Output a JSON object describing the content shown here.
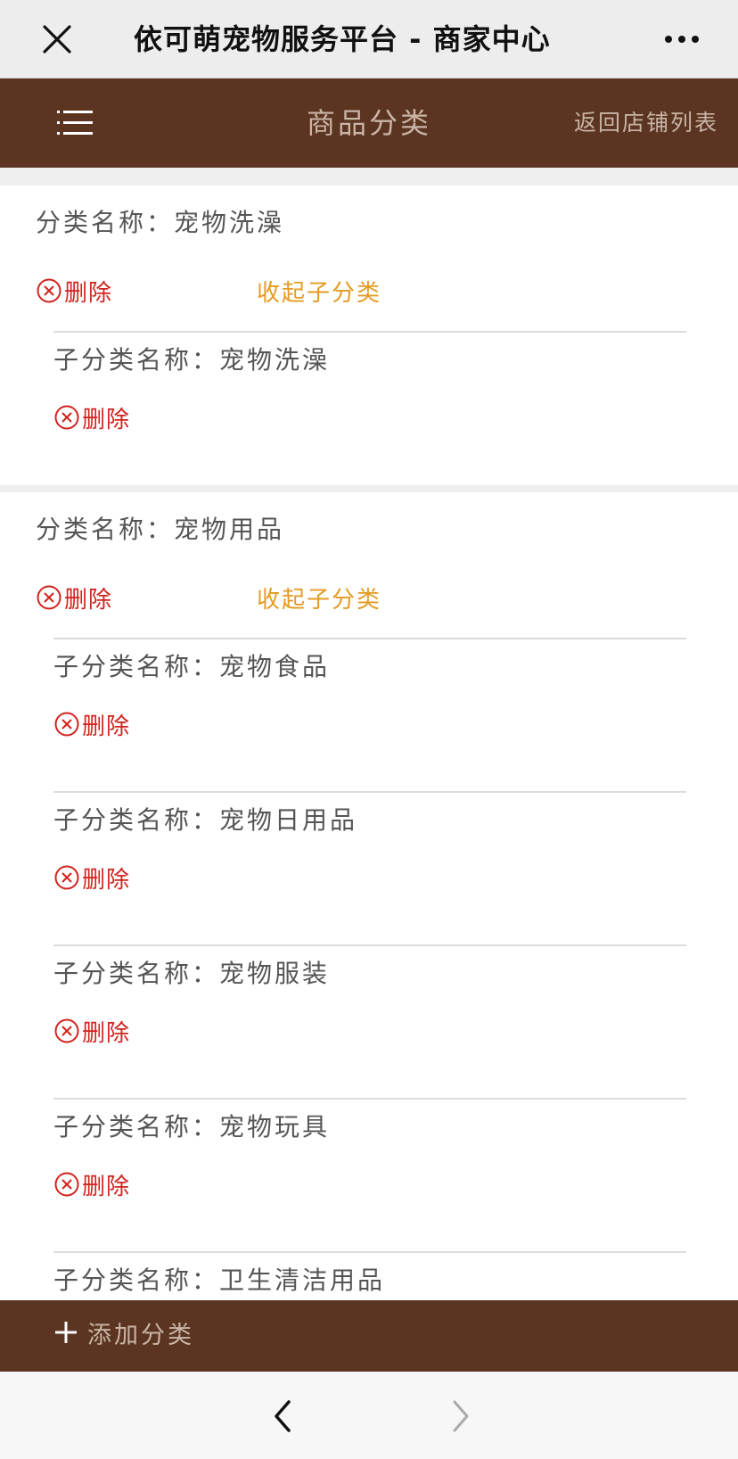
{
  "wechat_bar": {
    "title": "依可萌宠物服务平台 - 商家中心",
    "close_icon": "close-icon",
    "more_icon": "more-icon"
  },
  "header": {
    "title": "商品分类",
    "back_link": "返回店铺列表",
    "menu_icon": "hamburger-icon"
  },
  "labels": {
    "category_prefix": "分类名称：",
    "subcategory_prefix": "子分类名称：",
    "delete": "删除",
    "collapse": "收起子分类"
  },
  "categories": [
    {
      "name": "宠物洗澡",
      "subcategories": [
        "宠物洗澡"
      ]
    },
    {
      "name": "宠物用品",
      "subcategories": [
        "宠物食品",
        "宠物日用品",
        "宠物服装",
        "宠物玩具",
        "卫生清洁用品"
      ]
    }
  ],
  "footer": {
    "add_label": "添加分类"
  },
  "colors": {
    "brand_brown": "#5b3521",
    "delete_red": "#d1231e",
    "collapse_orange": "#e49b24"
  }
}
